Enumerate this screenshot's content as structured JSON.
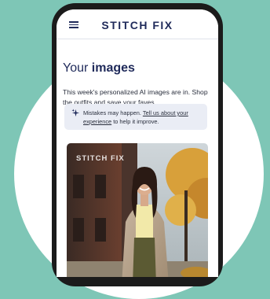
{
  "app": {
    "brand": "STITCH FIX",
    "menu_icon": "hamburger-menu-icon"
  },
  "page": {
    "title_prefix": "Your",
    "title_emphasis": "images",
    "intro": "This week's personalized AI images are in. Shop the outfits and save your faves."
  },
  "notice": {
    "icon": "sparkle-icon",
    "text_before": "Mistakes may happen.",
    "link_text": "Tell us about your experience",
    "text_after": "to help it improve."
  },
  "hero": {
    "watermark": "STITCH FIX",
    "description_icon": "ai-generated-photo"
  },
  "colors": {
    "background": "#7ec6b6",
    "brand_navy": "#1f2a5a",
    "notice_bg": "#eaedf5"
  }
}
